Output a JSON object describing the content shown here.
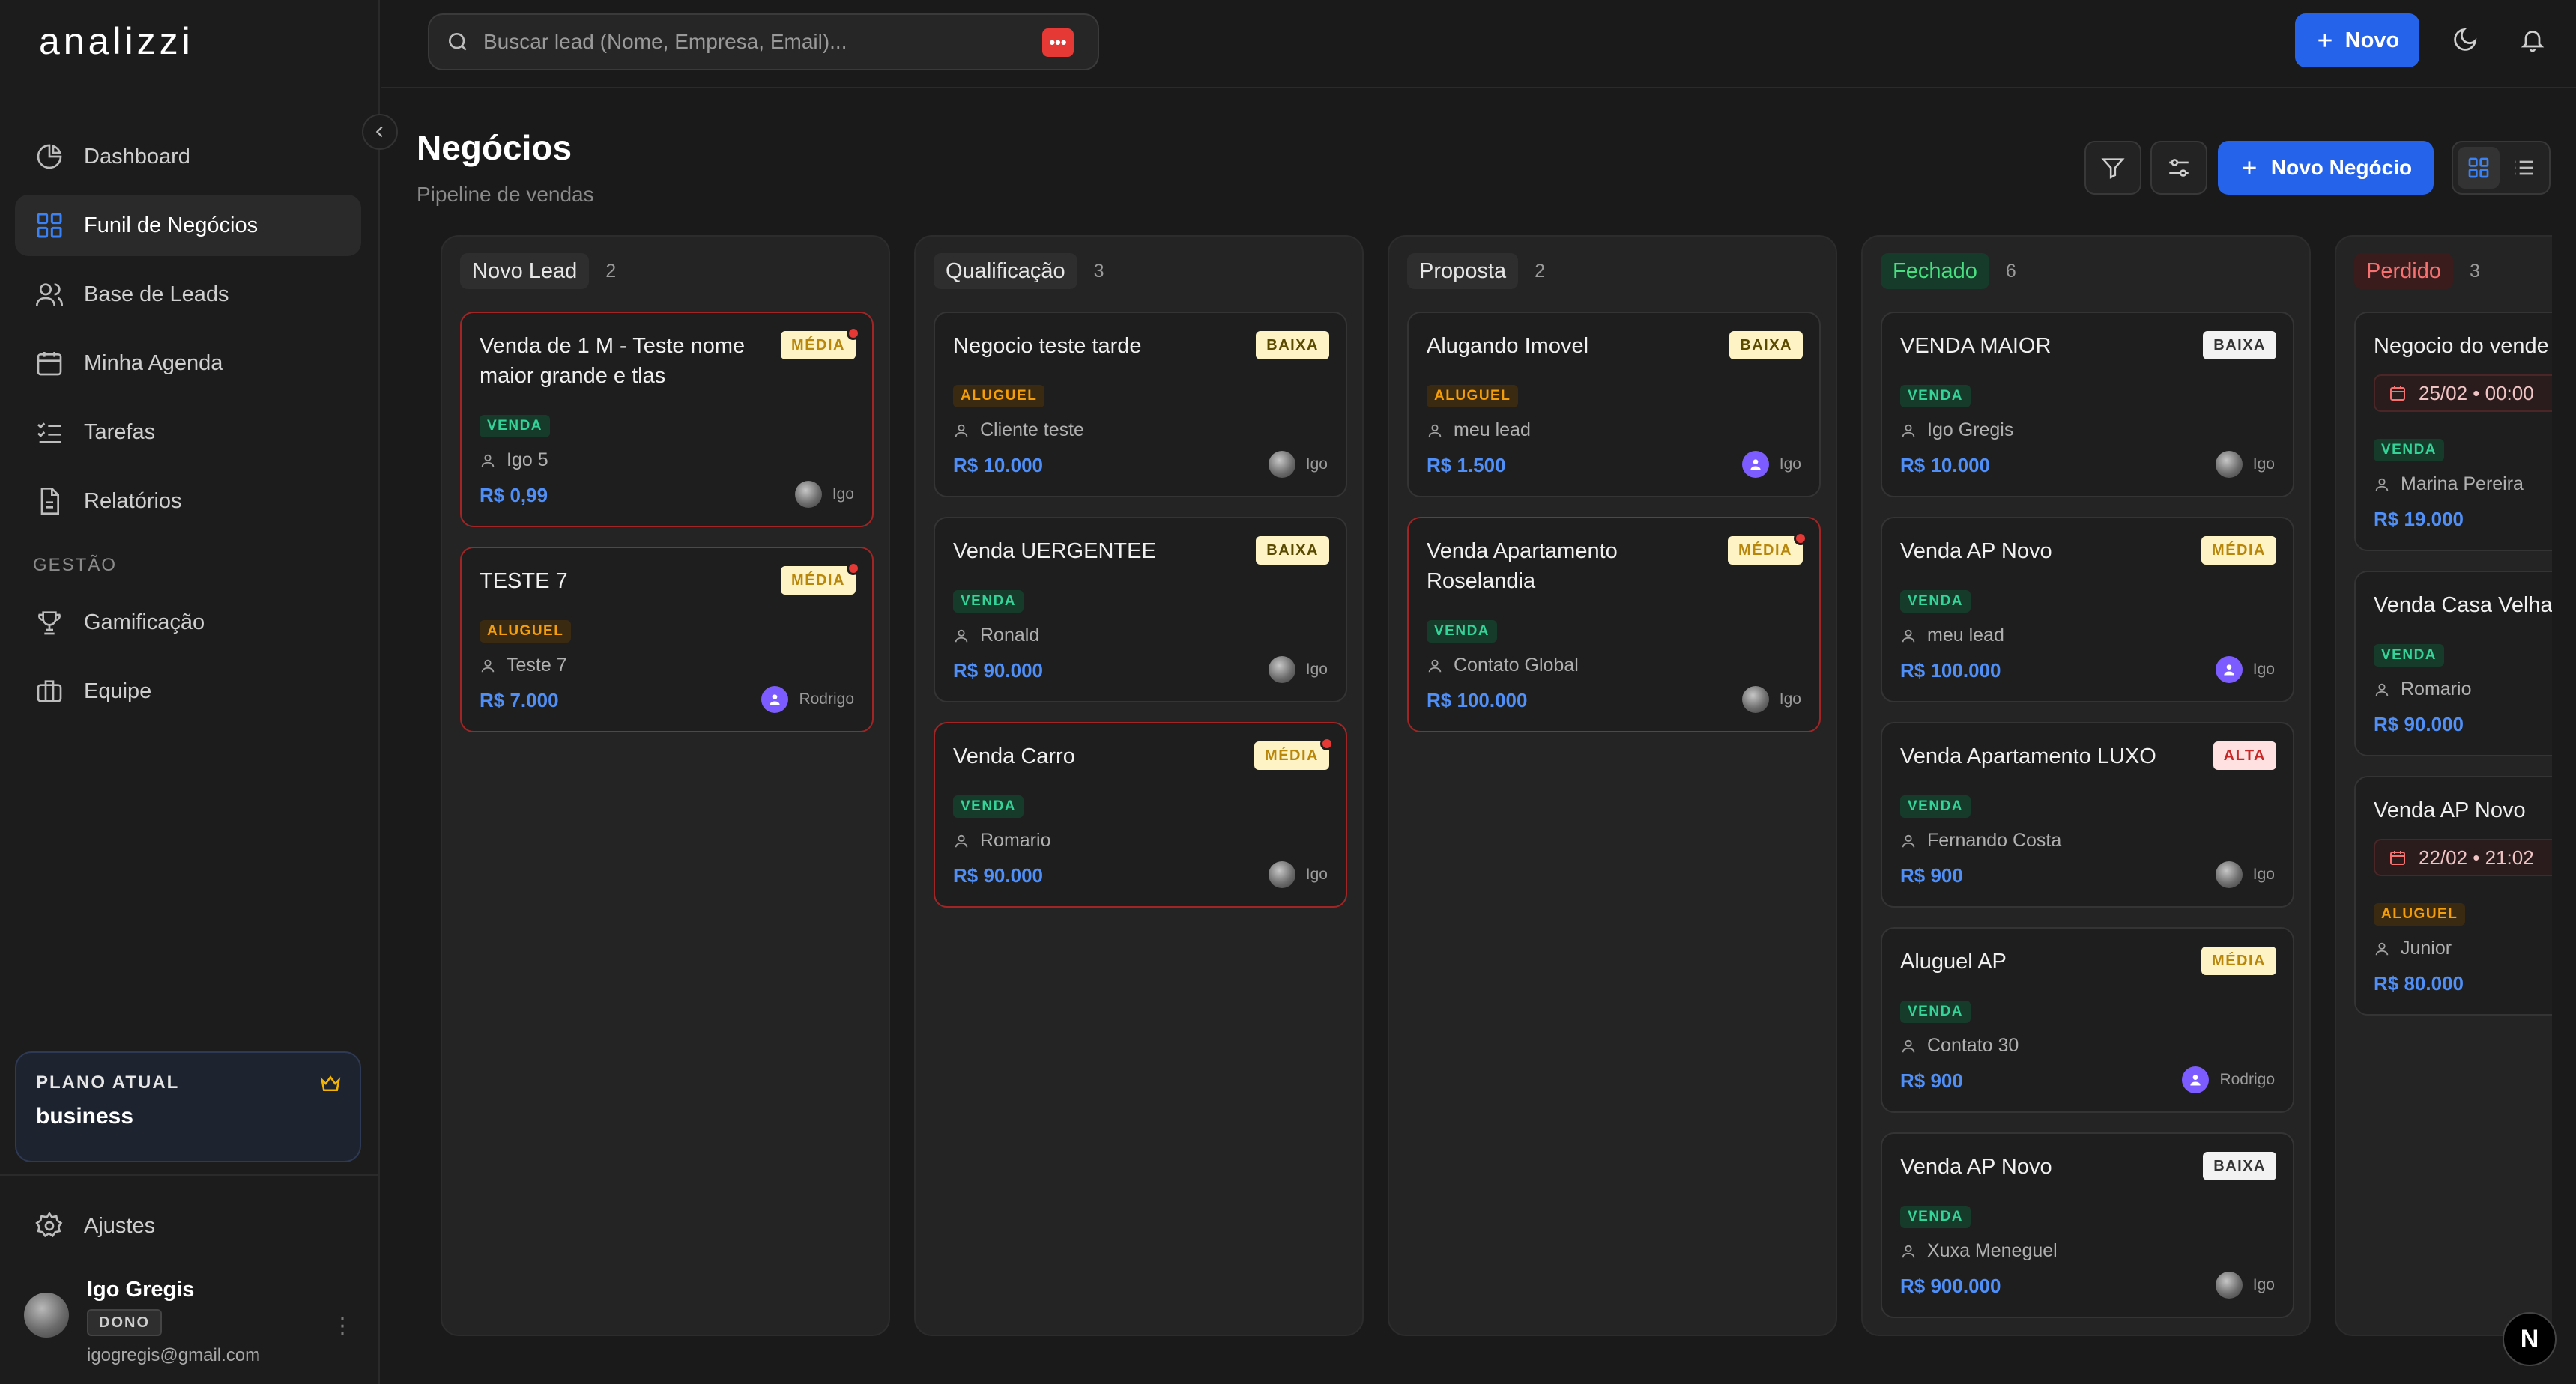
{
  "app": {
    "logo": "analizzi"
  },
  "sidebar": {
    "nav": [
      {
        "label": "Dashboard",
        "icon": "pie-chart-icon"
      },
      {
        "label": "Funil de Negócios",
        "icon": "grid-icon",
        "active": true
      },
      {
        "label": "Base de Leads",
        "icon": "users-icon"
      },
      {
        "label": "Minha Agenda",
        "icon": "calendar-icon"
      },
      {
        "label": "Tarefas",
        "icon": "list-check-icon"
      },
      {
        "label": "Relatórios",
        "icon": "file-icon"
      }
    ],
    "section_label": "GESTÃO",
    "section_items": [
      {
        "label": "Gamificação",
        "icon": "trophy-icon"
      },
      {
        "label": "Equipe",
        "icon": "briefcase-icon"
      }
    ],
    "plan": {
      "label": "PLANO ATUAL",
      "value": "business"
    },
    "settings_label": "Ajustes",
    "user": {
      "name": "Igo Gregis",
      "role": "DONO",
      "email": "igogregis@gmail.com"
    }
  },
  "topbar": {
    "search_placeholder": "Buscar lead (Nome, Empresa, Email)...",
    "new_button": "Novo"
  },
  "page": {
    "title": "Negócios",
    "subtitle": "Pipeline de vendas",
    "new_deal_button": "Novo Negócio"
  },
  "colors": {
    "accent": "#2563eb",
    "value": "#4f8ff7",
    "alert": "#e53935"
  },
  "columns": [
    {
      "title": "Novo Lead",
      "count": "2",
      "cards": [
        {
          "title": "Venda de 1 M - Teste nome maior grande e tlas",
          "priority": "MÉDIA",
          "type": "VENDA",
          "contact": "Igo 5",
          "value": "R$ 0,99",
          "owner": "Igo"
        },
        {
          "title": "TESTE 7",
          "priority": "MÉDIA",
          "type": "ALUGUEL",
          "contact": "Teste 7",
          "value": "R$ 7.000",
          "owner": "Rodrigo"
        }
      ]
    },
    {
      "title": "Qualificação",
      "count": "3",
      "cards": [
        {
          "title": "Negocio teste tarde",
          "priority": "BAIXA",
          "type": "ALUGUEL",
          "contact": "Cliente teste",
          "value": "R$ 10.000",
          "owner": "Igo"
        },
        {
          "title": "Venda UERGENTEE",
          "priority": "BAIXA",
          "type": "VENDA",
          "contact": "Ronald",
          "value": "R$ 90.000",
          "owner": "Igo"
        },
        {
          "title": "Venda Carro",
          "priority": "MÉDIA",
          "type": "VENDA",
          "contact": "Romario",
          "value": "R$ 90.000",
          "owner": "Igo"
        }
      ]
    },
    {
      "title": "Proposta",
      "count": "2",
      "cards": [
        {
          "title": "Alugando Imovel",
          "priority": "BAIXA",
          "type": "ALUGUEL",
          "contact": "meu lead",
          "value": "R$ 1.500",
          "owner": "Igo"
        },
        {
          "title": "Venda Apartamento Roselandia",
          "priority": "MÉDIA",
          "type": "VENDA",
          "contact": "Contato Global",
          "value": "R$ 100.000",
          "owner": "Igo"
        }
      ]
    },
    {
      "title": "Fechado",
      "count": "6",
      "cards": [
        {
          "title": "VENDA MAIOR",
          "priority": "BAIXA",
          "type": "VENDA",
          "contact": "Igo Gregis",
          "value": "R$ 10.000",
          "owner": "Igo"
        },
        {
          "title": "Venda AP Novo",
          "priority": "MÉDIA",
          "type": "VENDA",
          "contact": "meu lead",
          "value": "R$ 100.000",
          "owner": "Igo"
        },
        {
          "title": "Venda Apartamento LUXO",
          "priority": "ALTA",
          "type": "VENDA",
          "contact": "Fernando Costa",
          "value": "R$ 900",
          "owner": "Igo"
        },
        {
          "title": "Aluguel AP",
          "priority": "MÉDIA",
          "type": "VENDA",
          "contact": "Contato 30",
          "value": "R$ 900",
          "owner": "Rodrigo"
        },
        {
          "title": "Venda AP Novo",
          "priority": "BAIXA",
          "type": "VENDA",
          "contact": "Xuxa Meneguel",
          "value": "R$ 900.000",
          "owner": "Igo"
        }
      ]
    },
    {
      "title": "Perdido",
      "count": "3",
      "cards": [
        {
          "title": "Negocio do vende",
          "date": "25/02 • 00:00",
          "type": "VENDA",
          "contact": "Marina Pereira",
          "value": "R$ 19.000"
        },
        {
          "title": "Venda Casa Velha",
          "type": "VENDA",
          "contact": "Romario",
          "value": "R$ 90.000"
        },
        {
          "title": "Venda AP Novo",
          "date": "22/02 • 21:02",
          "type": "ALUGUEL",
          "contact": "Junior",
          "value": "R$ 80.000"
        }
      ]
    }
  ],
  "dev_badge": "N"
}
